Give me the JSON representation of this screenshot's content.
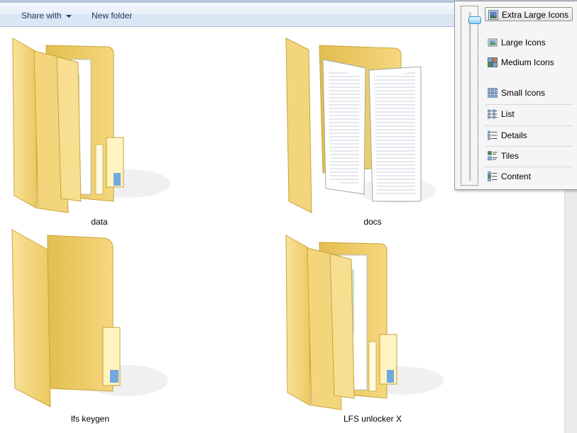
{
  "toolbar": {
    "share_label": "Share with",
    "new_folder_label": "New folder"
  },
  "folders": [
    {
      "name": "data",
      "kind": "documents"
    },
    {
      "name": "docs",
      "kind": "papers"
    },
    {
      "name": "lfs keygen",
      "kind": "empty"
    },
    {
      "name": "LFS unlocker X",
      "kind": "documents"
    }
  ],
  "view_menu": {
    "items": [
      {
        "label": "Extra Large Icons",
        "icon": "extra-large-icons-icon",
        "selected": true
      },
      {
        "label": "Large Icons",
        "icon": "large-icons-icon"
      },
      {
        "label": "Medium Icons",
        "icon": "medium-icons-icon"
      },
      {
        "label": "Small Icons",
        "icon": "small-icons-icon"
      },
      {
        "label": "List",
        "icon": "list-icon"
      },
      {
        "label": "Details",
        "icon": "details-icon"
      },
      {
        "label": "Tiles",
        "icon": "tiles-icon"
      },
      {
        "label": "Content",
        "icon": "content-icon"
      }
    ]
  },
  "colors": {
    "folder_back": "#e8c75a",
    "folder_front": "#f7dc8a",
    "accent": "#3f8fc4"
  }
}
